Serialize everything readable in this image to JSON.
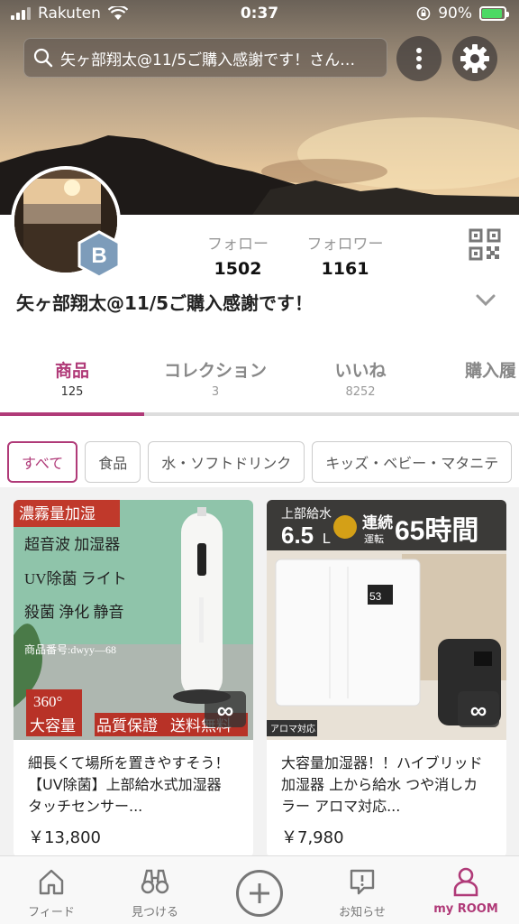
{
  "status": {
    "carrier": "Rakuten",
    "time": "0:37",
    "battery": "90%"
  },
  "search": {
    "text": "矢ヶ部翔太@11/5ご購入感謝です！さん…"
  },
  "profile": {
    "badge_letter": "B",
    "following_label": "フォロー",
    "following_count": "1502",
    "followers_label": "フォロワー",
    "followers_count": "1161",
    "name": "矢ヶ部翔太@11/5ご購入感謝です！"
  },
  "tabs": [
    {
      "label": "商品",
      "count": "125"
    },
    {
      "label": "コレクション",
      "count": "3"
    },
    {
      "label": "いいね",
      "count": "8252"
    },
    {
      "label": "購入履",
      "count": ""
    }
  ],
  "chips": [
    "すべて",
    "食品",
    "水・ソフトドリンク",
    "キッズ・ベビー・マタニテ"
  ],
  "products": [
    {
      "img_text": {
        "tag": "濃霧量加湿",
        "line1": "超音波 加湿器",
        "line2": "UV除菌 ライト",
        "line3": "殺菌 浄化 静音",
        "code": "商品番号:dwyy—68",
        "deg": "360°",
        "cap": "大容量",
        "quality": "品質保證",
        "ship": "送料無料"
      },
      "title": "細長くて場所を置きやすそう！【UV除菌】上部給水式加湿器　タッチセンサー...",
      "price": "￥13,800"
    },
    {
      "img_text": {
        "top": "上部給水",
        "size": "6.5",
        "unit": "L",
        "cont1": "連続",
        "cont2": "運転",
        "hours": "65時間",
        "display": "53",
        "aroma": "アロマ対応"
      },
      "title": "大容量加湿器！！ハイブリッド加湿器 上から給水 つや消しカラー アロマ対応...",
      "price": "￥7,980"
    }
  ],
  "nav": [
    {
      "label": "フィード"
    },
    {
      "label": "見つける"
    },
    {
      "label": "お知らせ"
    },
    {
      "label": "my ROOM"
    }
  ],
  "colors": {
    "accent": "#b03a78",
    "search_bg": "#5a504b",
    "badge": "#7a9ab8"
  }
}
